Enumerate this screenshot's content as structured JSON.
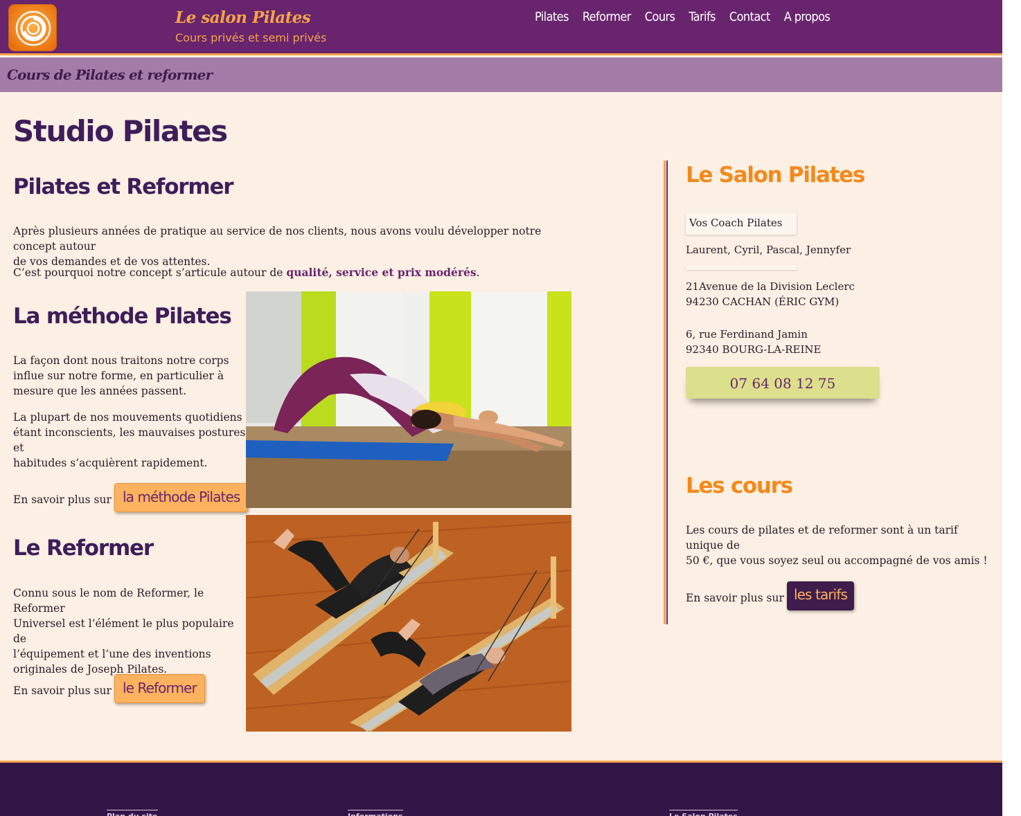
{
  "header": {
    "site_title": "Le salon Pilates",
    "site_subtitle": "Cours privés et semi privés",
    "nav": [
      "Pilates",
      "Reformer",
      "Cours",
      "Tarifs",
      "Contact",
      "A propos"
    ]
  },
  "subbar": {
    "text": "Cours de Pilates et reformer"
  },
  "main": {
    "title": "Studio Pilates",
    "section1": {
      "heading": "Pilates et Reformer",
      "para1_line1": "Après plusieurs années de pratique au service de nos clients, nous avons voulu développer notre concept autour",
      "para1_line2": "de vos demandes et de vos attentes.",
      "para2_prefix": "C’est pourquoi notre concept s’articule autour de ",
      "para2_bold": "qualité, service et prix modérés",
      "para2_suffix": "."
    },
    "section2": {
      "heading": "La méthode Pilates",
      "para1": [
        "La façon dont nous traitons notre corps",
        "influe sur notre forme, en particulier à",
        "mesure que les années passent."
      ],
      "para2": [
        "La plupart de nos mouvements quotidiens",
        "étant inconscients, les mauvaises postures et",
        "habitudes s’acquièrent rapidement."
      ],
      "more_label": "En savoir plus sur :",
      "button": "la méthode Pilates"
    },
    "section3": {
      "heading": "Le Reformer",
      "para1": [
        "Connu sous le nom de Reformer, le Reformer",
        "Universel est l’élément le plus populaire de",
        "l’équipement et l’une des inventions",
        "originales de Joseph Pilates."
      ],
      "more_label": "En savoir plus sur :",
      "button": "le Reformer"
    }
  },
  "sidebar": {
    "heading1": "Le Salon Pilates",
    "coach_label": "Vos Coach Pilates",
    "coaches": "Laurent, Cyril, Pascal, Jennyfer",
    "address1_line1": "21Avenue de la Division Leclerc",
    "address1_line2": "94230 CACHAN (ÉRIC GYM)",
    "address2_line1": "6, rue Ferdinand Jamin",
    "address2_line2": "92340 BOURG-LA-REINE",
    "phone": "07 64 08 12 75",
    "heading2": "Les cours",
    "cours_line1": "Les cours de pilates et de reformer sont à un tarif unique de",
    "cours_line2": "50 €, que vous soyez seul ou accompagné de vos amis !",
    "more_label": "En savoir plus sur :",
    "button": "les tarifs"
  },
  "footer": {
    "col1": "Plan du site",
    "col2": "Informations",
    "col3": "Le Salon Pilates"
  },
  "colors": {
    "header_purple": "#68256d",
    "accent_orange": "#f7a24a",
    "subbar_lilac": "#a47ca8",
    "page_bg": "#fcefe3",
    "footer_purple": "#341548",
    "phone_bg": "#dcdf8c"
  },
  "icons": {
    "logo": "orange-spiral-logo"
  }
}
